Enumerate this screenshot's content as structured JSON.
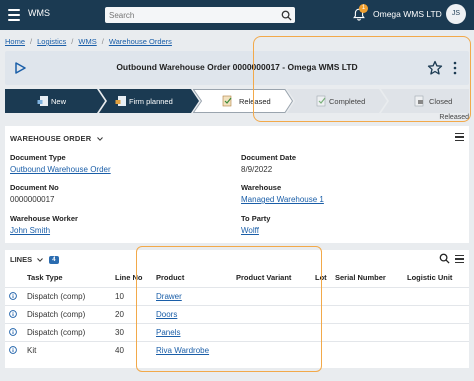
{
  "app": {
    "name": "WMS",
    "company": "Omega WMS LTD",
    "user_initials": "JS",
    "notifications": "1"
  },
  "search": {
    "placeholder": "Search"
  },
  "breadcrumb": [
    "Home",
    "Logistics",
    "WMS",
    "Warehouse Orders"
  ],
  "page": {
    "title": "Outbound Warehouse Order 0000000017 - Omega WMS LTD"
  },
  "status_steps": [
    {
      "label": "New"
    },
    {
      "label": "Firm planned"
    },
    {
      "label": "Released"
    },
    {
      "label": "Completed"
    },
    {
      "label": "Closed"
    }
  ],
  "current_status": "Released",
  "order": {
    "section_title": "WAREHOUSE ORDER",
    "fields": {
      "document_type": {
        "label": "Document Type",
        "value": "Outbound Warehouse Order"
      },
      "document_date": {
        "label": "Document Date",
        "value": "8/9/2022"
      },
      "document_no": {
        "label": "Document No",
        "value": "0000000017"
      },
      "warehouse": {
        "label": "Warehouse",
        "value": "Managed Warehouse 1"
      },
      "warehouse_worker": {
        "label": "Warehouse Worker",
        "value": "John Smith"
      },
      "to_party": {
        "label": "To Party",
        "value": "Wolff"
      }
    }
  },
  "lines": {
    "title": "LINES",
    "count": "4",
    "columns": [
      "Task Type",
      "Line No",
      "Product",
      "Product Variant",
      "Lot",
      "Serial Number",
      "Logistic Unit"
    ],
    "rows": [
      {
        "task_type": "Dispatch (comp)",
        "line_no": "10",
        "product": "Drawer"
      },
      {
        "task_type": "Dispatch (comp)",
        "line_no": "20",
        "product": "Doors"
      },
      {
        "task_type": "Dispatch (comp)",
        "line_no": "30",
        "product": "Panels"
      },
      {
        "task_type": "Kit",
        "line_no": "40",
        "product": "Riva Wardrobe"
      }
    ]
  },
  "colors": {
    "topbar": "#1b3a52",
    "step_done": "#1b3a52",
    "step_current": "#ffffff",
    "step_future": "#dfe3e8",
    "accent": "#f2a94a",
    "link": "#1a5ea8"
  },
  "icons": [
    "menu-icon",
    "search-icon",
    "bell-icon",
    "play-icon",
    "star-icon",
    "kebab-icon",
    "info-icon",
    "list-icon"
  ]
}
